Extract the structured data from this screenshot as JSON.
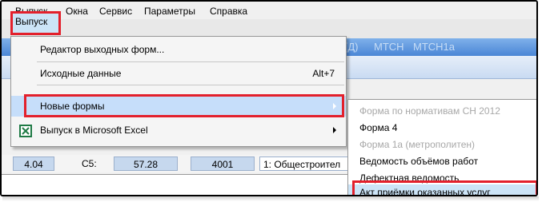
{
  "menubar": {
    "items": [
      "Выпуск",
      "Окна",
      "Сервис",
      "Параметры",
      "Справка"
    ]
  },
  "background": {
    "tabs": [
      "(Д)",
      "МТСН",
      "МТСН1а"
    ],
    "row": {
      "v1": "4.04",
      "label": "C5:",
      "v2": "57.28",
      "v3": "4001",
      "v4": "1: Общестроител"
    }
  },
  "main_menu": {
    "items": [
      {
        "label": "Редактор выходных форм..."
      },
      {
        "label": "Исходные данные",
        "shortcut": "Alt+7"
      },
      {
        "label": "",
        "shortcut": ""
      },
      {
        "label": "Новые формы"
      },
      {
        "label": "Выпуск в Microsoft Excel"
      }
    ]
  },
  "submenu": {
    "items": [
      {
        "label": "Форма по нормативам СН 2012",
        "disabled": true
      },
      {
        "label": "Форма 4",
        "disabled": false
      },
      {
        "label": "Форма 1а (метрополитен)",
        "disabled": true
      },
      {
        "label": "Ведомость объёмов работ",
        "disabled": false
      },
      {
        "label": "Дефектная ведомость",
        "disabled": false
      },
      {
        "label": "Акт приёмки оказанных услуг",
        "disabled": false
      }
    ]
  },
  "colors": {
    "highlight": "#e3202c",
    "tab_bar": "#4a86d6",
    "excel_icon": "#1f7a45"
  }
}
